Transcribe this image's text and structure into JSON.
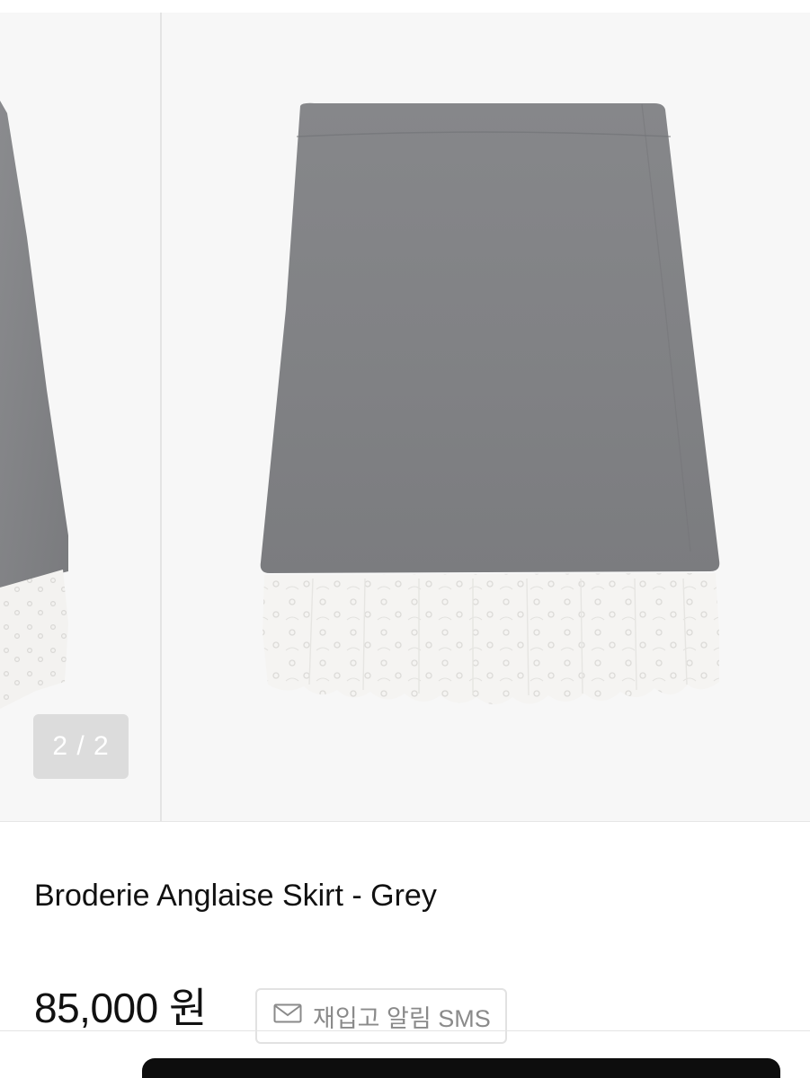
{
  "product": {
    "name": "Broderie Anglaise Skirt - Grey",
    "price": "85,000 원",
    "images": [
      {
        "alt": "grey wool skirt with broderie lace hem, previous image"
      },
      {
        "alt": "grey wool skirt with broderie lace hem"
      }
    ]
  },
  "gallery": {
    "counter": "2 / 2",
    "current_index": 2,
    "total": 2
  },
  "restock": {
    "label": "재입고 알림 SMS",
    "icon": "mail-icon"
  },
  "colors": {
    "skirt_grey": "#828386",
    "lace_white": "#f4f3f1",
    "text": "#111111",
    "counter_bg": "#dcdcdc",
    "bottom_bar": "#0d0d0d"
  }
}
